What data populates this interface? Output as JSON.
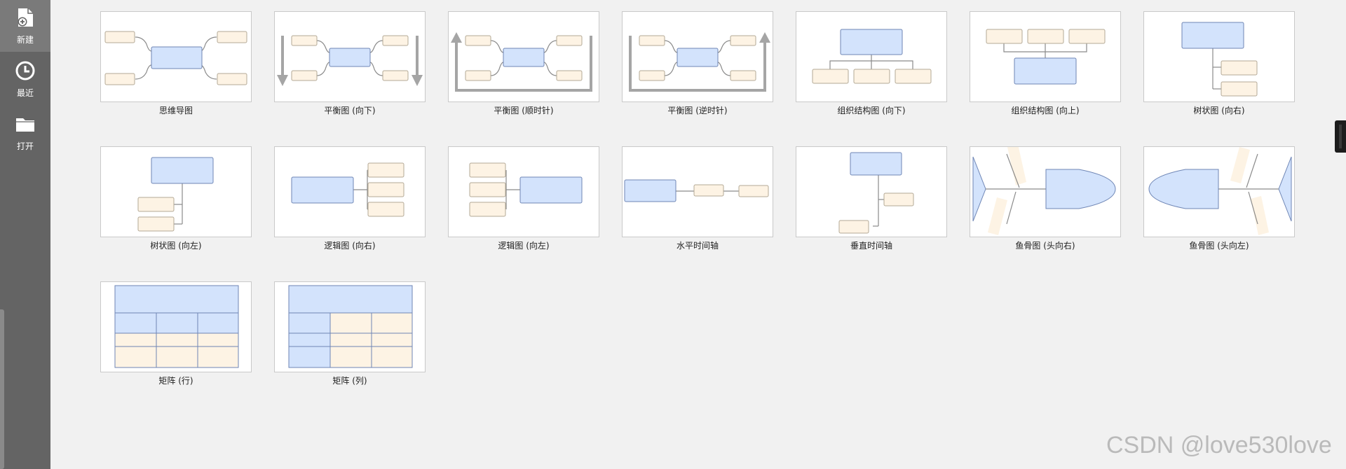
{
  "sidebar": {
    "items": [
      {
        "label": "新建",
        "icon": "new-file-icon"
      },
      {
        "label": "最近",
        "icon": "clock-icon"
      },
      {
        "label": "打开",
        "icon": "folder-icon"
      }
    ]
  },
  "templates": [
    {
      "label": "思维导图",
      "icon": "mind-map-icon"
    },
    {
      "label": "平衡图 (向下)",
      "icon": "balance-down-icon"
    },
    {
      "label": "平衡图 (顺时针)",
      "icon": "balance-clockwise-icon"
    },
    {
      "label": "平衡图 (逆时针)",
      "icon": "balance-counterclockwise-icon"
    },
    {
      "label": "组织结构图 (向下)",
      "icon": "org-chart-down-icon"
    },
    {
      "label": "组织结构图 (向上)",
      "icon": "org-chart-up-icon"
    },
    {
      "label": "树状图 (向右)",
      "icon": "tree-right-icon"
    },
    {
      "label": "树状图 (向左)",
      "icon": "tree-left-icon"
    },
    {
      "label": "逻辑图 (向右)",
      "icon": "logic-right-icon"
    },
    {
      "label": "逻辑图 (向左)",
      "icon": "logic-left-icon"
    },
    {
      "label": "水平时间轴",
      "icon": "horizontal-timeline-icon"
    },
    {
      "label": "垂直时间轴",
      "icon": "vertical-timeline-icon"
    },
    {
      "label": "鱼骨图 (头向右)",
      "icon": "fishbone-right-icon"
    },
    {
      "label": "鱼骨图 (头向左)",
      "icon": "fishbone-left-icon"
    },
    {
      "label": "矩阵 (行)",
      "icon": "matrix-row-icon"
    },
    {
      "label": "矩阵 (列)",
      "icon": "matrix-column-icon"
    }
  ],
  "watermark": "CSDN @love530love",
  "colors": {
    "node_blue": "#d3e3fc",
    "node_blue_border": "#6f86b5",
    "node_beige": "#fdf3e4",
    "node_beige_border": "#b3a996",
    "sidebar_bg": "#646464"
  }
}
